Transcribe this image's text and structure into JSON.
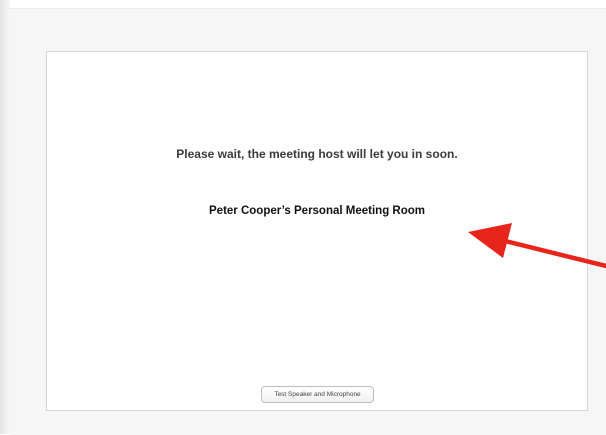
{
  "waiting_room": {
    "wait_message": "Please wait, the meeting host will let you in soon.",
    "room_title": "Peter Cooper’s Personal Meeting Room",
    "test_button_label": "Test Speaker and Microphone"
  },
  "colors": {
    "annotation_arrow": "#e8251b",
    "panel_border": "#d6d6d6",
    "window_background": "#f6f6f6"
  },
  "annotation": {
    "type": "arrow",
    "icon": "red-arrow-icon"
  }
}
